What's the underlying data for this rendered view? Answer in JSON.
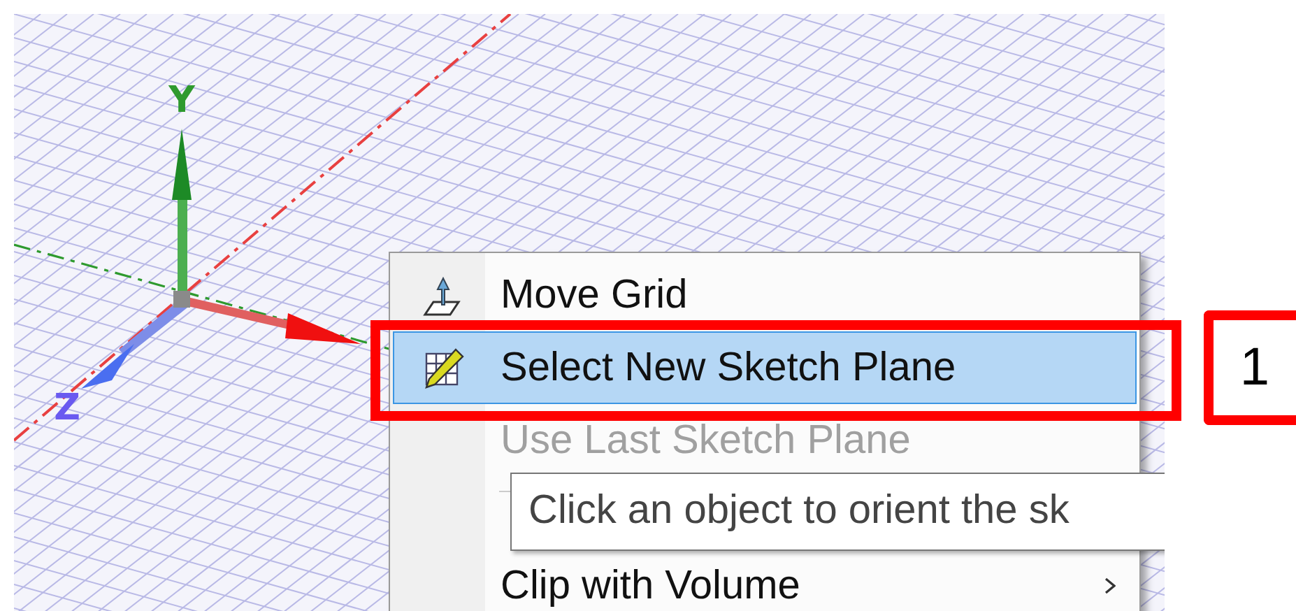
{
  "viewport": {
    "axis_labels": [
      {
        "kind": "y",
        "label": "Y"
      },
      {
        "kind": "z",
        "label": "Z"
      }
    ]
  },
  "context_menu": {
    "items": [
      {
        "kind": "move-grid",
        "label": "Move Grid",
        "selected": false,
        "disabled": false
      },
      {
        "kind": "sketch-plane",
        "label": "Select New Sketch Plane",
        "selected": true,
        "disabled": false
      },
      {
        "kind": "none",
        "label": "Use Last Sketch Plane",
        "selected": false,
        "disabled": true
      },
      {
        "kind": "separator"
      },
      {
        "kind": "none",
        "label": "Clip with Volume",
        "selected": false,
        "disabled": false,
        "submenu": true
      }
    ]
  },
  "tooltip": {
    "text": "Click an object to orient the sk"
  },
  "callout": {
    "label": "1"
  }
}
